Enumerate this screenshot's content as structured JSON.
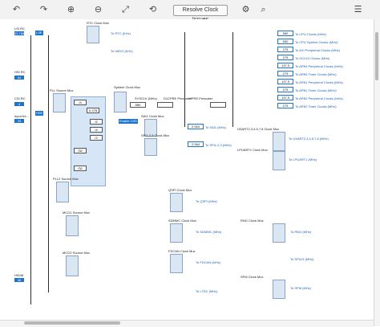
{
  "toolbar": {
    "resolve_label": "Resolve Clock Issues",
    "icons": [
      "undo-icon",
      "redo-icon",
      "zoom-in-icon",
      "zoom-out-icon",
      "fit-icon",
      "reset-icon",
      "gear-icon",
      "search-icon"
    ]
  },
  "inputs": {
    "lse": "LSE",
    "hsi": "HSI",
    "csi": "CSI",
    "hse": "HSE",
    "lsi_label": "LSI RC",
    "hsi_label": "HSI RC",
    "csi_label": "CSI RC",
    "hse_label": "Input fre..."
  },
  "labels": {
    "rtc_mux": "RTC Clock Mux",
    "pll_source_mux": "PLL Source Mux",
    "system_clock_mux": "System Clock Mux",
    "sysclk": "SYSCLK (MHz)",
    "d1cpre": "D1CPRE Prescaler",
    "hpre": "HPRE Prescaler",
    "to_rtc": "To RTC (KHz)",
    "to_iwdg": "To IWDG (KHz)",
    "sai_mux": "SAI1 Clock Mux",
    "spi123": "SPI1,2,3 Clock Mux",
    "usart": "USART2,3,4,5,7,8 Clock Mux",
    "lpuart": "LPUART1 Clock Mux",
    "qspi": "QSPI Clock Mux",
    "sdmmc": "SDMMC Clock Mux",
    "fdcan": "FDCAN Clock Mux",
    "rng": "RNG Clock Mux",
    "spi6": "SPI6 Clock Mux",
    "mco1": "MCO1 Source Mux",
    "mco2": "MCO2 Source Mux",
    "pll2_mux": "PLL2 Source Mux",
    "enable_css": "Enable CSS",
    "hsi48": "HSI48"
  },
  "values": {
    "sysclk_val": "550",
    "d1cpre_val": "/1",
    "hpre_val": "/2",
    "cpu_clock": "550",
    "hclk": "275",
    "divm1": "/4",
    "divn1": "X 275",
    "divp1": "/2",
    "divq1": "/4",
    "divr1": "/2",
    "divm2": "/32",
    "divm3": "/32",
    "hse_val": "25",
    "hsi_val": "64",
    "csi_val": "4",
    "lse_val": "32.768",
    "hsi48_val": "48"
  },
  "outputs": [
    {
      "value": "550",
      "label": "To CPU Clocks (MHz)"
    },
    {
      "value": "550",
      "label": "To CPU System Clocks (MHz)"
    },
    {
      "value": "275",
      "label": "To AXI Peripheral Clocks (MHz)"
    },
    {
      "value": "275",
      "label": "To HCLK3 Clocks (MHz)"
    },
    {
      "value": "137.5",
      "label": "To APB3 Peripheral Clocks (MHz)"
    },
    {
      "value": "275",
      "label": "To APB3 Timer Clocks (MHz)"
    },
    {
      "value": "137.5",
      "label": "To APB1 Peripheral Clocks (MHz)"
    },
    {
      "value": "275",
      "label": "To APB1 Timer Clocks (MHz)"
    },
    {
      "value": "137.5",
      "label": "To APB2 Peripheral Clocks (MHz)"
    },
    {
      "value": "275",
      "label": "To APB2 Timer Clocks (MHz)"
    }
  ],
  "peripheral_outputs": [
    {
      "value": "2.064",
      "label": "To SAI1 (MHz)"
    },
    {
      "value": "2.064",
      "label": "To SPI1,2,3 (MHz)"
    },
    {
      "value": "137.5",
      "label": "To USART2,3,4,5,7,8 (MHz)"
    },
    {
      "value": "137.5",
      "label": "To LPUART1 (MHz)"
    },
    {
      "value": "275",
      "label": "To QSPI (MHz)"
    },
    {
      "value": "137.5",
      "label": "To SDMMC (MHz)"
    },
    {
      "value": "137.5",
      "label": "To FDCAN (MHz)"
    },
    {
      "value": "48",
      "label": "To RNG (MHz)"
    },
    {
      "value": "137.5",
      "label": "To SPI6 (MHz)"
    },
    {
      "value": "137.5",
      "label": "To SPI4,5 (MHz)"
    },
    {
      "value": "137.5",
      "label": "To LTDC (MHz)"
    }
  ],
  "colors": {
    "accent": "#1f73c8",
    "toolbar_bg": "#f2f2f2"
  }
}
